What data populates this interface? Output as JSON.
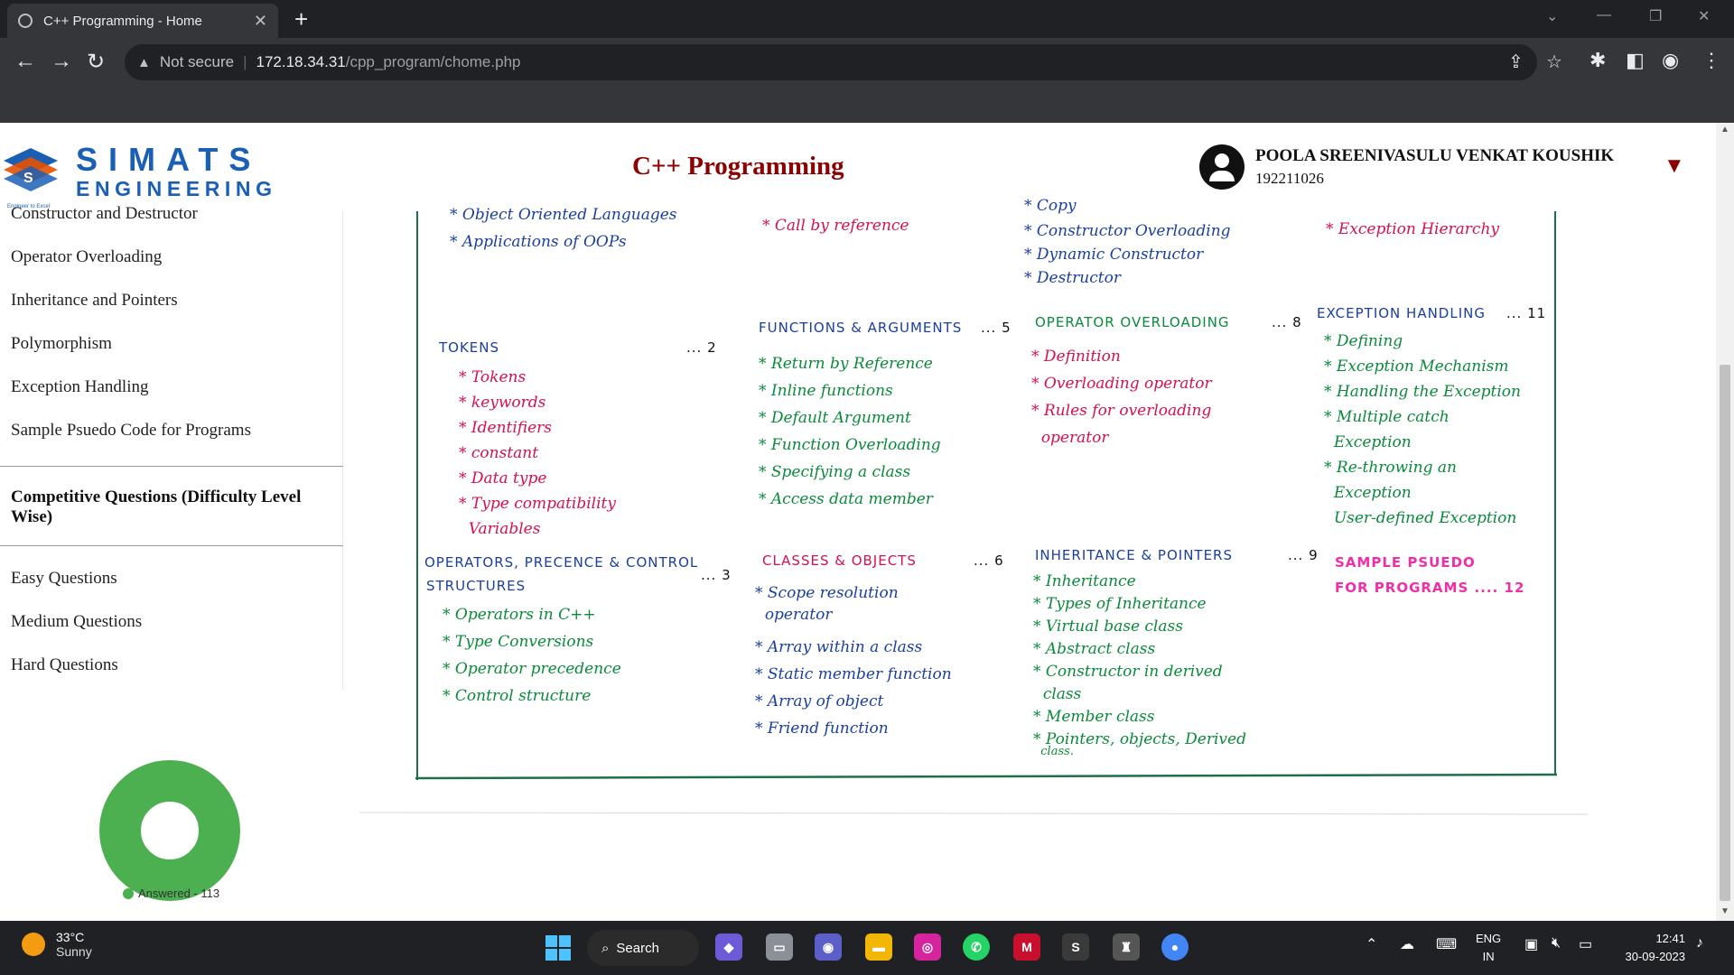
{
  "browser": {
    "tab_title": "C++ Programming - Home",
    "tab_close": "✕",
    "new_tab": "+",
    "security_label": "Not secure",
    "url_host": "172.18.34.31",
    "url_path": "/cpp_program/chome.php",
    "window_controls": [
      "⌄",
      "—",
      "❐",
      "✕"
    ]
  },
  "header": {
    "logo_word1": "SIMATS",
    "logo_word2": "ENGINEERING",
    "logo_tagline": "Engineer to Excel",
    "course_title": "C++ Programming",
    "user_name": "POOLA SREENIVASULU VENKAT KOUSHIK",
    "user_id": "192211026",
    "dropdown_icon": "▼"
  },
  "sidebar": {
    "items": [
      "Constructor and Destructor",
      "Operator Overloading",
      "Inheritance and Pointers",
      "Polymorphism",
      "Exception Handling",
      "Sample Psuedo Code for Programs"
    ],
    "section_header": "Competitive Questions (Difficulty Level Wise)",
    "levels": [
      "Easy Questions",
      "Medium Questions",
      "Hard Questions"
    ]
  },
  "progress": {
    "legend": "Answered - 113",
    "answered_fraction": 1.0,
    "color": "#4caf50"
  },
  "board": {
    "top_col1": [
      "Object Oriented Languages",
      "Applications of OOPs"
    ],
    "top_col2": [
      "Call by reference"
    ],
    "top_col3": [
      "Copy",
      "Constructor Overloading",
      "Dynamic Constructor",
      "Destructor"
    ],
    "top_col4": [
      "Exception Hierarchy"
    ],
    "tokens": {
      "title": "TOKENS",
      "num": "... 2",
      "items": [
        "Tokens",
        "keywords",
        "Identifiers",
        "constant",
        "Data type",
        "Type compatibility",
        "Variables"
      ]
    },
    "functions": {
      "title": "FUNCTIONS & ARGUMENTS",
      "num": "... 5",
      "items": [
        "Return by Reference",
        "Inline functions",
        "Default Argument",
        "Function Overloading",
        "Specifying a class",
        "Access data member"
      ]
    },
    "operator_overloading": {
      "title": "OPERATOR OVERLOADING",
      "num": "... 8",
      "items": [
        "Definition",
        "Overloading operator",
        "Rules for overloading",
        "operator"
      ]
    },
    "exception_handling": {
      "title": "EXCEPTION HANDLING",
      "num": "... 11",
      "items": [
        "Defining",
        "Exception Mechanism",
        "Handling the Exception",
        "Multiple catch",
        "Exception",
        "Re-throwing an",
        "Exception",
        "User-defined Exception"
      ]
    },
    "operators": {
      "title_line1": "OPERATORS, PRECENCE & CONTROL",
      "title_line2": "STRUCTURES",
      "num": "... 3",
      "items": [
        "Operators in C++",
        "Type Conversions",
        "Operator precedence",
        "Control structure"
      ]
    },
    "classes": {
      "title": "CLASSES & OBJECTS",
      "num": "... 6",
      "items": [
        "Scope resolution",
        "operator",
        "Array within a class",
        "Static member function",
        "Array of object",
        "Friend function"
      ]
    },
    "inheritance": {
      "title": "INHERITANCE & POINTERS",
      "num": "... 9",
      "items": [
        "Inheritance",
        "Types of Inheritance",
        "Virtual base class",
        "Abstract class",
        "Constructor in derived",
        "class",
        "Member class",
        "Pointers, objects, Derived",
        "class."
      ]
    },
    "sample": {
      "line1": "SAMPLE PSUEDO",
      "line2": "FOR PROGRAMS .... 12"
    },
    "bullet": "*",
    "colors": {
      "green": "#0a8a3a",
      "red": "#d6114b",
      "blue": "#1a3f9e",
      "pink": "#ef2fa8"
    }
  },
  "taskbar": {
    "temperature": "33°C",
    "weather": "Sunny",
    "search_label": "Search",
    "lang_line1": "ENG",
    "lang_line2": "IN",
    "time": "12:41",
    "date": "30-09-2023"
  }
}
